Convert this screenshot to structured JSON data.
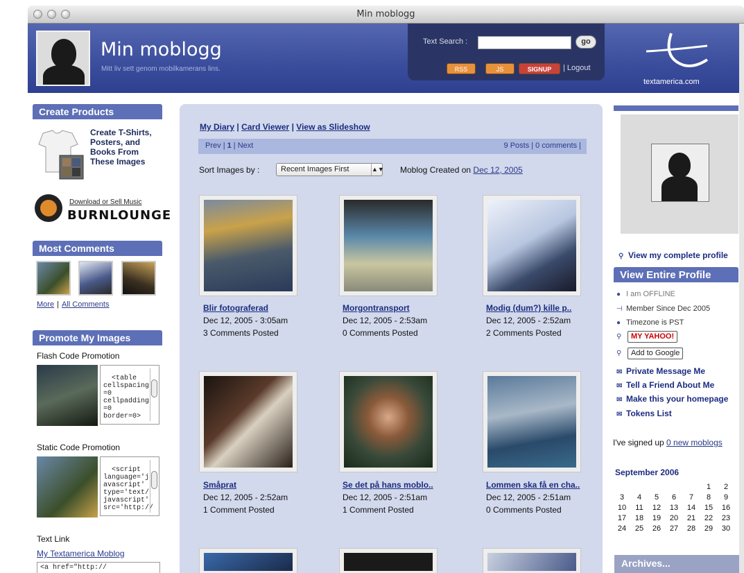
{
  "window": {
    "title": "Min moblogg"
  },
  "header": {
    "title": "Min moblogg",
    "subtitle": "Mitt liv sett genom mobilkamerans lins.",
    "search_label": "Text Search :",
    "search_value": "",
    "go_label": "go",
    "buttons": {
      "rss": "RSS",
      "js": "JS",
      "signup": "SIGNUP"
    },
    "logout": "| Logout",
    "logo_text": "textamerica.com",
    "colors": {
      "banner": "#3a4d9c",
      "signup": "#c9423a",
      "rss": "#e8913b"
    }
  },
  "left": {
    "create_products": {
      "title": "Create Products",
      "text": "Create T-Shirts, Posters, and Books From These Images"
    },
    "burnlounge": {
      "link": "Download or Sell Music",
      "name": "BURNLOUNGE"
    },
    "most_comments": {
      "title": "Most Comments",
      "more": "More",
      "all": "All Comments",
      "separator": "|"
    },
    "promote": {
      "title": "Promote My Images",
      "flash_label": "Flash Code Promotion",
      "flash_code": "<table\ncellspacing\n=0\ncellpadding\n=0\nborder=0>",
      "static_label": "Static Code Promotion",
      "static_code": "<script\nlanguage='j\navascript'\ntype='text/\njavascript'\nsrc='http://",
      "text_link_label": "Text Link",
      "text_link": "My Textamerica Moblog",
      "text_link_code": "<a href=\"http://"
    }
  },
  "main": {
    "nav": {
      "diary": "My Diary",
      "card": "Card Viewer",
      "slideshow": "View as Slideshow",
      "sep": "|"
    },
    "pager": {
      "prev": "Prev",
      "page": "1",
      "next": "Next",
      "sep": "|",
      "summary": "9 Posts | 0 comments |"
    },
    "sort_label": "Sort Images by :",
    "sort_value": "Recent Images First",
    "created_label": "Moblog Created on",
    "created_date": "Dec 12, 2005",
    "posts": [
      {
        "title": "Blir fotograferad",
        "date": "Dec 12, 2005 - 3:05am",
        "comments": "3 Comments Posted"
      },
      {
        "title": "Morgontransport",
        "date": "Dec 12, 2005 - 2:53am",
        "comments": "0 Comments Posted"
      },
      {
        "title": "Modig (dum?) kille p..",
        "date": "Dec 12, 2005 - 2:52am",
        "comments": "2 Comments Posted"
      },
      {
        "title": "Småprat",
        "date": "Dec 12, 2005 - 2:52am",
        "comments": "1 Comment Posted"
      },
      {
        "title": "Se det på hans moblo..",
        "date": "Dec 12, 2005 - 2:51am",
        "comments": "1 Comment Posted"
      },
      {
        "title": "Lommen ska få en cha..",
        "date": "Dec 12, 2005 - 2:51am",
        "comments": "0 Comments Posted"
      }
    ]
  },
  "right": {
    "view_profile": "View my complete profile",
    "entire_profile": "View Entire Profile",
    "offline": "I am OFFLINE",
    "member_since": "Member Since Dec 2005",
    "timezone": "Timezone is PST",
    "my_yahoo": "MY YAHOO!",
    "add_google": "Add to Google",
    "private_message": "Private Message Me",
    "tell_friend": "Tell a Friend About Me",
    "homepage": "Make this your homepage",
    "tokens": "Tokens List",
    "signed_up_text": "I've signed up",
    "signed_up_link": "0 new moblogs",
    "calendar": {
      "month": "September 2006",
      "weeks": [
        [
          "",
          "",
          "",
          "",
          "",
          "1",
          "2"
        ],
        [
          "3",
          "4",
          "5",
          "6",
          "7",
          "8",
          "9"
        ],
        [
          "10",
          "11",
          "12",
          "13",
          "14",
          "15",
          "16"
        ],
        [
          "17",
          "18",
          "19",
          "20",
          "21",
          "22",
          "23"
        ],
        [
          "24",
          "25",
          "26",
          "27",
          "28",
          "29",
          "30"
        ]
      ]
    },
    "archives": "Archives..."
  }
}
